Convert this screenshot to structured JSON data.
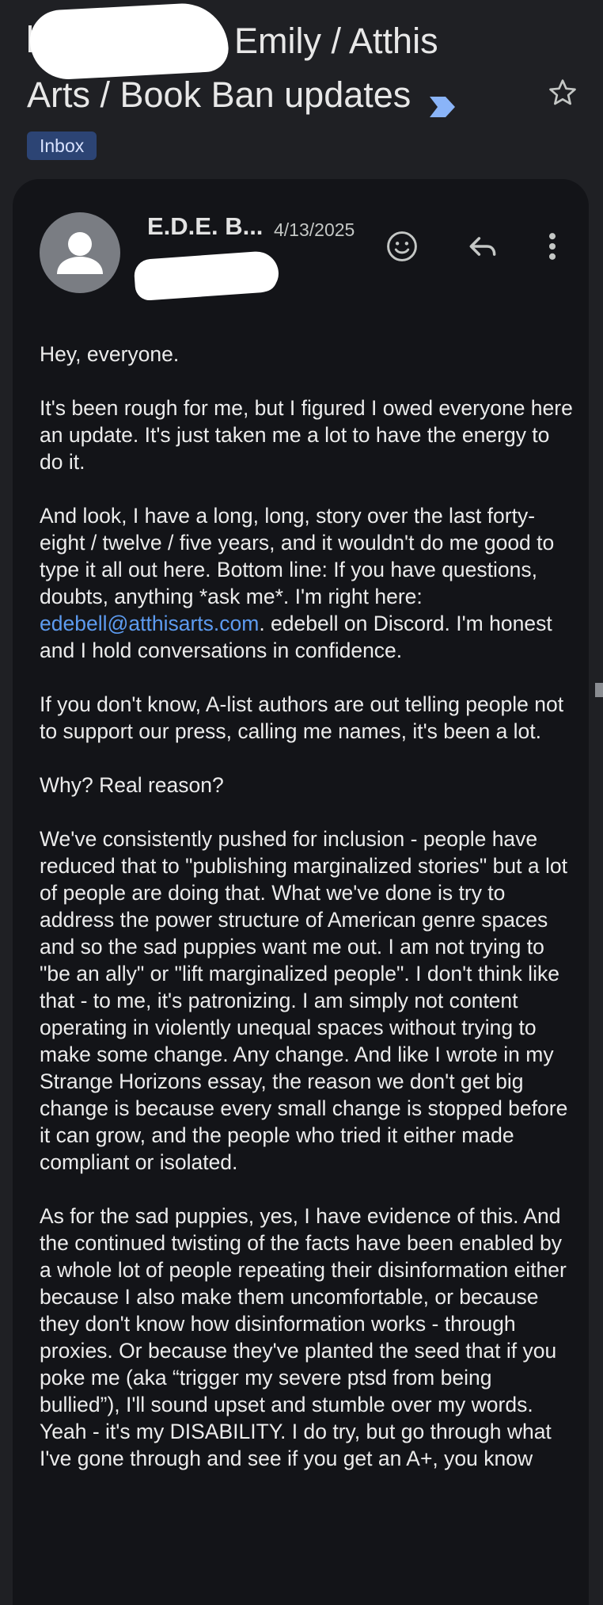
{
  "header": {
    "prefix_char": "[",
    "subject_line1": "Emily / Atthis",
    "subject_line2": "Arts / Book Ban updates",
    "label_chip": "Inbox"
  },
  "message": {
    "sender_name": "E.D.E. B...",
    "date": "4/13/2025",
    "body": {
      "p1": "Hey, everyone.",
      "p2": "It's been rough for me, but I figured I owed everyone here an update. It's just taken me a lot to have the energy to do it.",
      "p3_before_link": "And look, I have a long, long, story over the last forty-eight / twelve / five years, and it wouldn't do me good to type it all out here. Bottom line: If you have questions, doubts, anything *ask me*. I'm right here: ",
      "p3_link": "edebell@atthisarts.com",
      "p3_after_link": ". edebell on Discord. I'm honest and I hold conversations in confidence.",
      "p4": "If you don't know, A-list authors are out telling people not to support our press, calling me names, it's been a lot.",
      "p5": "Why? Real reason?",
      "p6": "We've consistently pushed for inclusion - people have reduced that to \"publishing marginalized stories\" but a lot of people are doing that. What we've done is try to address the power structure of American genre spaces and so the sad puppies want me out. I am not trying to \"be an ally\" or \"lift marginalized people\". I don't think like that - to me, it's patronizing. I am simply not content operating in violently unequal spaces without trying to make some change. Any change. And like I wrote in my Strange Horizons essay, the reason we don't get big change is because every small change is stopped before it can grow, and the people who tried it either made compliant or isolated.",
      "p7": "As for the sad puppies, yes, I have evidence of this. And the continued twisting of the facts have been enabled by a whole lot of people repeating their disinformation either because I also make them uncomfortable, or because they don't know how disinformation works - through proxies. Or because they've planted the seed that if you poke me (aka “trigger my severe ptsd from being bullied”), I'll sound upset and stumble over my words. Yeah - it's my DISABILITY. I do try, but go through what I've gone through and see if you get an A+, you know"
    }
  },
  "colors": {
    "background": "#1f2024",
    "card": "#131418",
    "chip_bg": "#2c4474",
    "link": "#5d9bf0",
    "important_marker": "#8ab4f8"
  },
  "icons": {
    "important": "important-marker-icon",
    "star": "star-icon",
    "emoji": "add-reaction-icon",
    "reply": "reply-icon",
    "more": "more-vert-icon",
    "avatar": "person-icon"
  }
}
